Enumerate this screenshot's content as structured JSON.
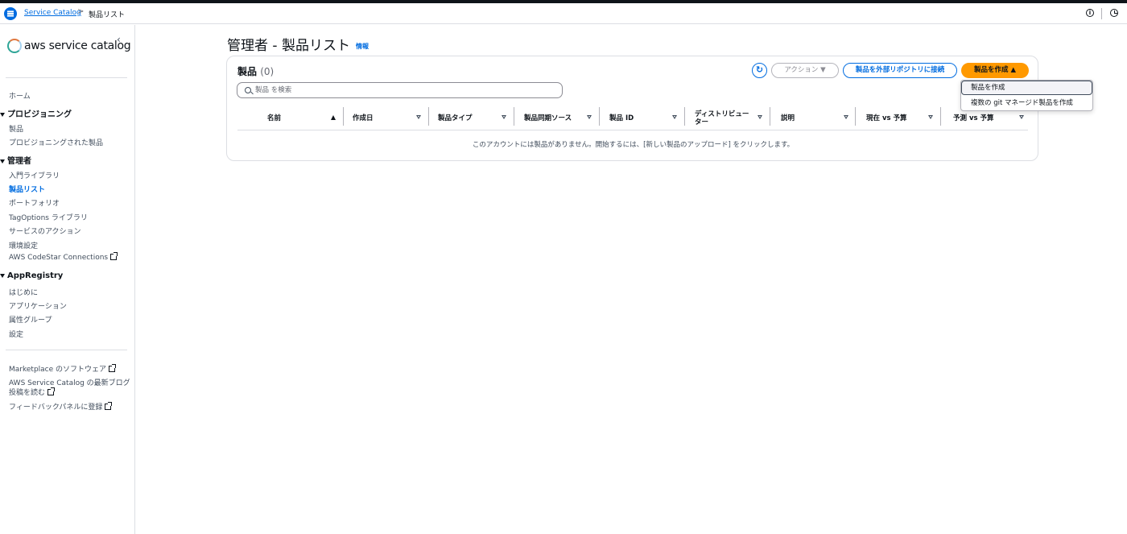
{
  "topbar": {
    "breadcrumb_link": "Service Catalog",
    "breadcrumb_separator": ">",
    "breadcrumb_current": "製品リスト",
    "icons": [
      "menu-icon",
      "info-icon",
      "clock-icon"
    ]
  },
  "sidebar": {
    "logo": "aws service catalog",
    "collapse": "‹",
    "items": {
      "home": "ホーム",
      "provisioning_header": "プロビジョニング",
      "products": "製品",
      "provisioned_products": "プロビジョニングされた製品",
      "admin_header": "管理者",
      "getting_started_library": "入門ライブラリ",
      "product_list": "製品リスト",
      "portfolio": "ポートフォリオ",
      "tagoptions_library": "TagOptions ライブラリ",
      "service_actions": "サービスのアクション",
      "preferences": "環境設定",
      "codestar_connections": "AWS CodeStar Connections",
      "appregistry_header": "AppRegistry",
      "getting_started": "はじめに",
      "applications": "アプリケーション",
      "attribute_groups": "属性グループ",
      "settings": "設定",
      "marketplace": "Marketplace のソフトウェア",
      "blog_line1": "AWS Service Catalog の最新ブログ",
      "blog_line2": "投稿を読む",
      "feedback": "フィードバックパネルに登録"
    }
  },
  "main": {
    "title": "管理者 - 製品リスト",
    "info_link": "情報",
    "panel": {
      "title": "製品",
      "count": "(0)",
      "refresh_icon": "↻",
      "actions_label": "アクション ▼",
      "connect_label": "製品を外部リポジトリに接続",
      "create_label": "製品を作成 ▲",
      "search_placeholder": "製品 を検索",
      "columns": [
        "名前",
        "作成日",
        "製品タイプ",
        "製品同期ソース",
        "製品 ID",
        "ディストリビューター",
        "説明",
        "現在 vs 予算",
        "予測 vs 予算"
      ],
      "empty_message": "このアカウントには製品がありません。開始するには、[新しい製品のアップロード] をクリックします。"
    },
    "create_dropdown": [
      "製品を作成",
      "複数の git マネージド製品を作成"
    ]
  },
  "colors": {
    "primary": "#006ce0",
    "create_button": "#ff9900",
    "border": "#dcdee3"
  }
}
